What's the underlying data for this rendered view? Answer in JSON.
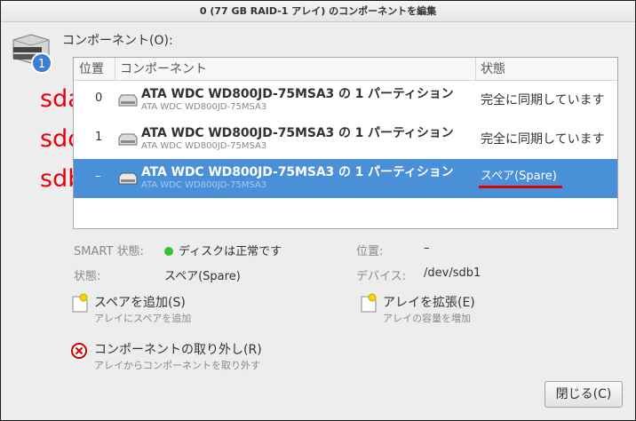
{
  "window": {
    "title": "0 (77 GB RAID-1 アレイ) のコンポーネントを編集",
    "heading": "コンポーネント(O):",
    "disk_badge": "1"
  },
  "table": {
    "columns": [
      "位置",
      "コンポーネント",
      "状態"
    ],
    "rows": [
      {
        "position": "0",
        "name": "ATA WDC WD800JD-75MSA3 の 1 パーティション",
        "sub": "ATA WDC WD800JD-75MSA3",
        "status": "完全に同期しています",
        "selected": false
      },
      {
        "position": "1",
        "name": "ATA WDC WD800JD-75MSA3 の 1 パーティション",
        "sub": "ATA WDC WD800JD-75MSA3",
        "status": "完全に同期しています",
        "selected": false
      },
      {
        "position": "–",
        "name": "ATA WDC WD800JD-75MSA3 の 1 パーティション",
        "sub": "ATA WDC WD800JD-75MSA3",
        "status": "スペア(Spare)",
        "selected": true
      }
    ]
  },
  "annotations": [
    "sda",
    "sdc",
    "sdb"
  ],
  "annotation_color": "#e8000d",
  "accent_color": "#4a90d9",
  "details": {
    "smart_label": "SMART 状態:",
    "smart_value": "ディスクは正常です",
    "smart_status_color": "#2dc72d",
    "state_label": "状態:",
    "state_value": "スペア(Spare)",
    "position_label": "位置:",
    "position_value": "–",
    "device_label": "デバイス:",
    "device_value": "/dev/sdb1"
  },
  "actions": {
    "add_spare": {
      "label": "スペアを追加(S)",
      "desc": "アレイにスペアを追加",
      "icon": "add-document-icon"
    },
    "expand": {
      "label": "アレイを拡張(E)",
      "desc": "アレイの容量を増加",
      "icon": "add-document-icon"
    },
    "remove": {
      "label": "コンポーネントの取り外し(R)",
      "desc": "アレイからコンポーネントを取り外す",
      "icon": "remove-icon"
    }
  },
  "close_button": "閉じる(C)"
}
